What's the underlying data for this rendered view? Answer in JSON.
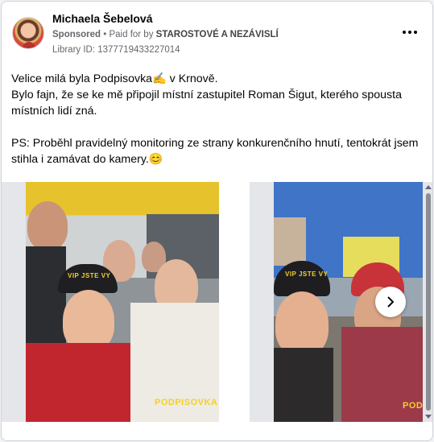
{
  "header": {
    "advertiser_name": "Michaela Šebelová",
    "sponsored_label": "Sponsored",
    "separator": " • ",
    "paid_for_prefix": "Paid for by ",
    "payer": "STAROSTOVÉ A NEZÁVISLÍ",
    "library_id": "Library ID: 1377719433227014",
    "more_icon": "more-options-icon",
    "more_glyph": "•••"
  },
  "post": {
    "line1": "Velice milá byla Podpisovka✍️  v Krnově.",
    "line2": "Bylo fajn, že se ke mě připojil místní zastupitel Roman Šigut, kterého spousta místních lidí zná.",
    "line3": "PS: Proběhl pravidelný monitoring ze strany konkurenčního hnutí, tentokrát jsem stihla i zamávat do kamery.😊"
  },
  "carousel": {
    "slide1_cap_text": "VIP JSTE VY",
    "slide1_brand": "PODPISOVKA",
    "slide2_cap_text": "VIP JSTE VY",
    "slide2_brand": "PODI",
    "next_icon": "chevron-right-icon"
  },
  "colors": {
    "accent_yellow": "#f3d12b",
    "text_primary": "#050505",
    "text_secondary": "#65676b"
  }
}
